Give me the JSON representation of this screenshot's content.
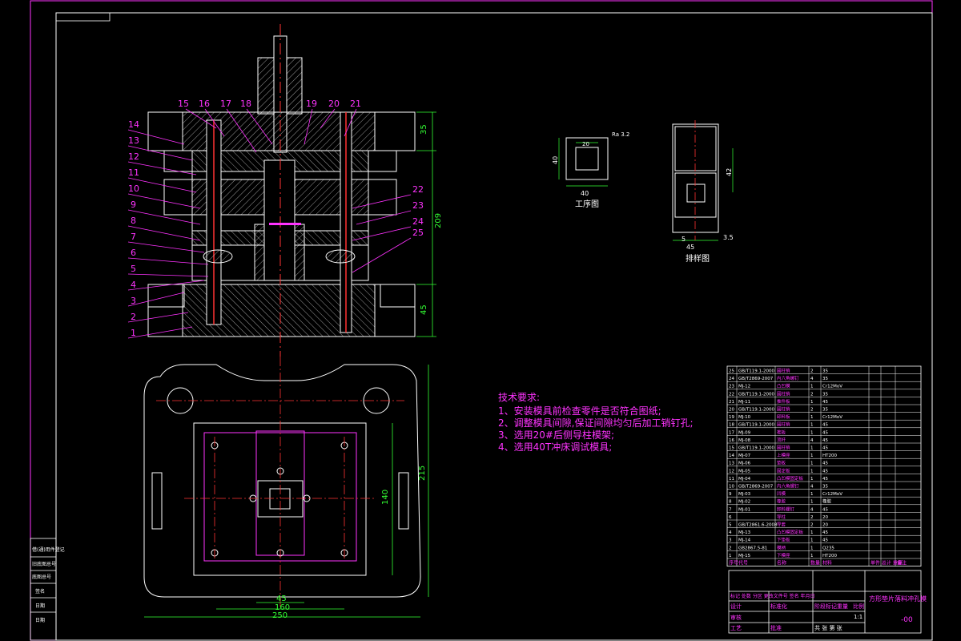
{
  "drawing": {
    "title": "方形垫片落料冲孔模",
    "drawing_number": "-00",
    "scale": "1:1",
    "sheet_info": "共 张   第 张"
  },
  "part_labels": [
    "15",
    "16",
    "17",
    "18",
    "19",
    "20",
    "21",
    "14",
    "13",
    "12",
    "11",
    "10",
    "9",
    "8",
    "7",
    "6",
    "5",
    "4",
    "3",
    "2",
    "1",
    "22",
    "23",
    "24",
    "25"
  ],
  "dimensions": {
    "height_top": "35",
    "height_total": "209",
    "height_bottom": "45",
    "width_45": "45",
    "width_160": "160",
    "width_250": "250",
    "height_215": "215",
    "height_140": "140",
    "part_width": "40",
    "part_height": "40",
    "hole_size": "20",
    "strip_width": "42",
    "strip_pitch": "45",
    "strip_feed": "5",
    "strip_edge": "3.5",
    "roughness": "Ra 3.2"
  },
  "views": {
    "workpiece_label": "工序图",
    "strip_label": "排样图"
  },
  "tech_requirements": {
    "title": "技术要求:",
    "items": [
      "1、安装模具前检查零件是否符合图纸;",
      "2、调整模具间隙,保证间隙均匀后加工销钉孔;",
      "3、选用20#后侧导柱模架;",
      "4、选用40T冲床调试模具;"
    ]
  },
  "bom_rows": [
    {
      "no": "25",
      "code": "GB/T119.1-2000",
      "name": "圆柱销",
      "qty": "2",
      "mat": "35"
    },
    {
      "no": "24",
      "code": "GB/T2869-2007",
      "name": "内六角螺钉",
      "qty": "4",
      "mat": "35"
    },
    {
      "no": "23",
      "code": "MJ-12",
      "name": "凸凹模",
      "qty": "1",
      "mat": "Cr12MoV"
    },
    {
      "no": "22",
      "code": "GB/T119.1-2000",
      "name": "圆柱销",
      "qty": "2",
      "mat": "35"
    },
    {
      "no": "21",
      "code": "MJ-11",
      "name": "推件板",
      "qty": "1",
      "mat": "45"
    },
    {
      "no": "20",
      "code": "GB/T119.1-2000",
      "name": "圆柱销",
      "qty": "2",
      "mat": "35"
    },
    {
      "no": "19",
      "code": "MJ-10",
      "name": "卸料板",
      "qty": "1",
      "mat": "Cr12MoV"
    },
    {
      "no": "18",
      "code": "GB/T119.1-2000",
      "name": "圆柱销",
      "qty": "1",
      "mat": "45"
    },
    {
      "no": "17",
      "code": "MJ-09",
      "name": "推板",
      "qty": "1",
      "mat": "45"
    },
    {
      "no": "16",
      "code": "MJ-08",
      "name": "顶杆",
      "qty": "4",
      "mat": "45"
    },
    {
      "no": "15",
      "code": "GB/T119.1-2000",
      "name": "圆柱销",
      "qty": "1",
      "mat": "45"
    },
    {
      "no": "14",
      "code": "MJ-07",
      "name": "上模座",
      "qty": "1",
      "mat": "HT200"
    },
    {
      "no": "13",
      "code": "MJ-06",
      "name": "垫板",
      "qty": "1",
      "mat": "45"
    },
    {
      "no": "12",
      "code": "MJ-05",
      "name": "固定板",
      "qty": "1",
      "mat": "45"
    },
    {
      "no": "11",
      "code": "MJ-04",
      "name": "凸凹模固定板",
      "qty": "1",
      "mat": "45"
    },
    {
      "no": "10",
      "code": "GB/T2869-2007",
      "name": "内六角螺钉",
      "qty": "4",
      "mat": "35"
    },
    {
      "no": "9",
      "code": "MJ-03",
      "name": "凹模",
      "qty": "1",
      "mat": "Cr12MoV"
    },
    {
      "no": "8",
      "code": "MJ-02",
      "name": "橡胶",
      "qty": "1",
      "mat": "橡胶"
    },
    {
      "no": "7",
      "code": "MJ-01",
      "name": "卸料螺钉",
      "qty": "4",
      "mat": "45"
    },
    {
      "no": "6",
      "code": "",
      "name": "导柱",
      "qty": "2",
      "mat": "20"
    },
    {
      "no": "5",
      "code": "GB/T2861.6-2008",
      "name": "导套",
      "qty": "2",
      "mat": "20"
    },
    {
      "no": "4",
      "code": "MJ-13",
      "name": "凸凹模固定板",
      "qty": "1",
      "mat": "45"
    },
    {
      "no": "3",
      "code": "MJ-14",
      "name": "下垫板",
      "qty": "1",
      "mat": "45"
    },
    {
      "no": "2",
      "code": "GB2867.5-81",
      "name": "模柄",
      "qty": "1",
      "mat": "Q235"
    },
    {
      "no": "1",
      "code": "MJ-15",
      "name": "下模座",
      "qty": "1",
      "mat": "HT200"
    }
  ],
  "bom_header": {
    "no": "序号",
    "code": "代号",
    "name": "名称",
    "qty": "数量",
    "mat": "材料",
    "weight": "单件 总计 重量",
    "remark": "备注"
  },
  "left_strip": [
    "借(通)用件登记",
    "旧底图总号",
    "底图总号",
    "签名",
    "日期",
    "日期"
  ],
  "title_block": {
    "rows": [
      "标记 处数 分区 更改文件号 签名 年月日",
      "设计",
      "审核",
      "工艺"
    ],
    "cols": [
      "标准化",
      "批准",
      "阶段标记",
      "重量",
      "比例"
    ]
  },
  "colors": {
    "background": "#000000",
    "line": "#ffffff",
    "border": "#ff33ff",
    "dimension": "#33ff33",
    "centerline": "#ff3333",
    "hatch": "#ffffff"
  }
}
